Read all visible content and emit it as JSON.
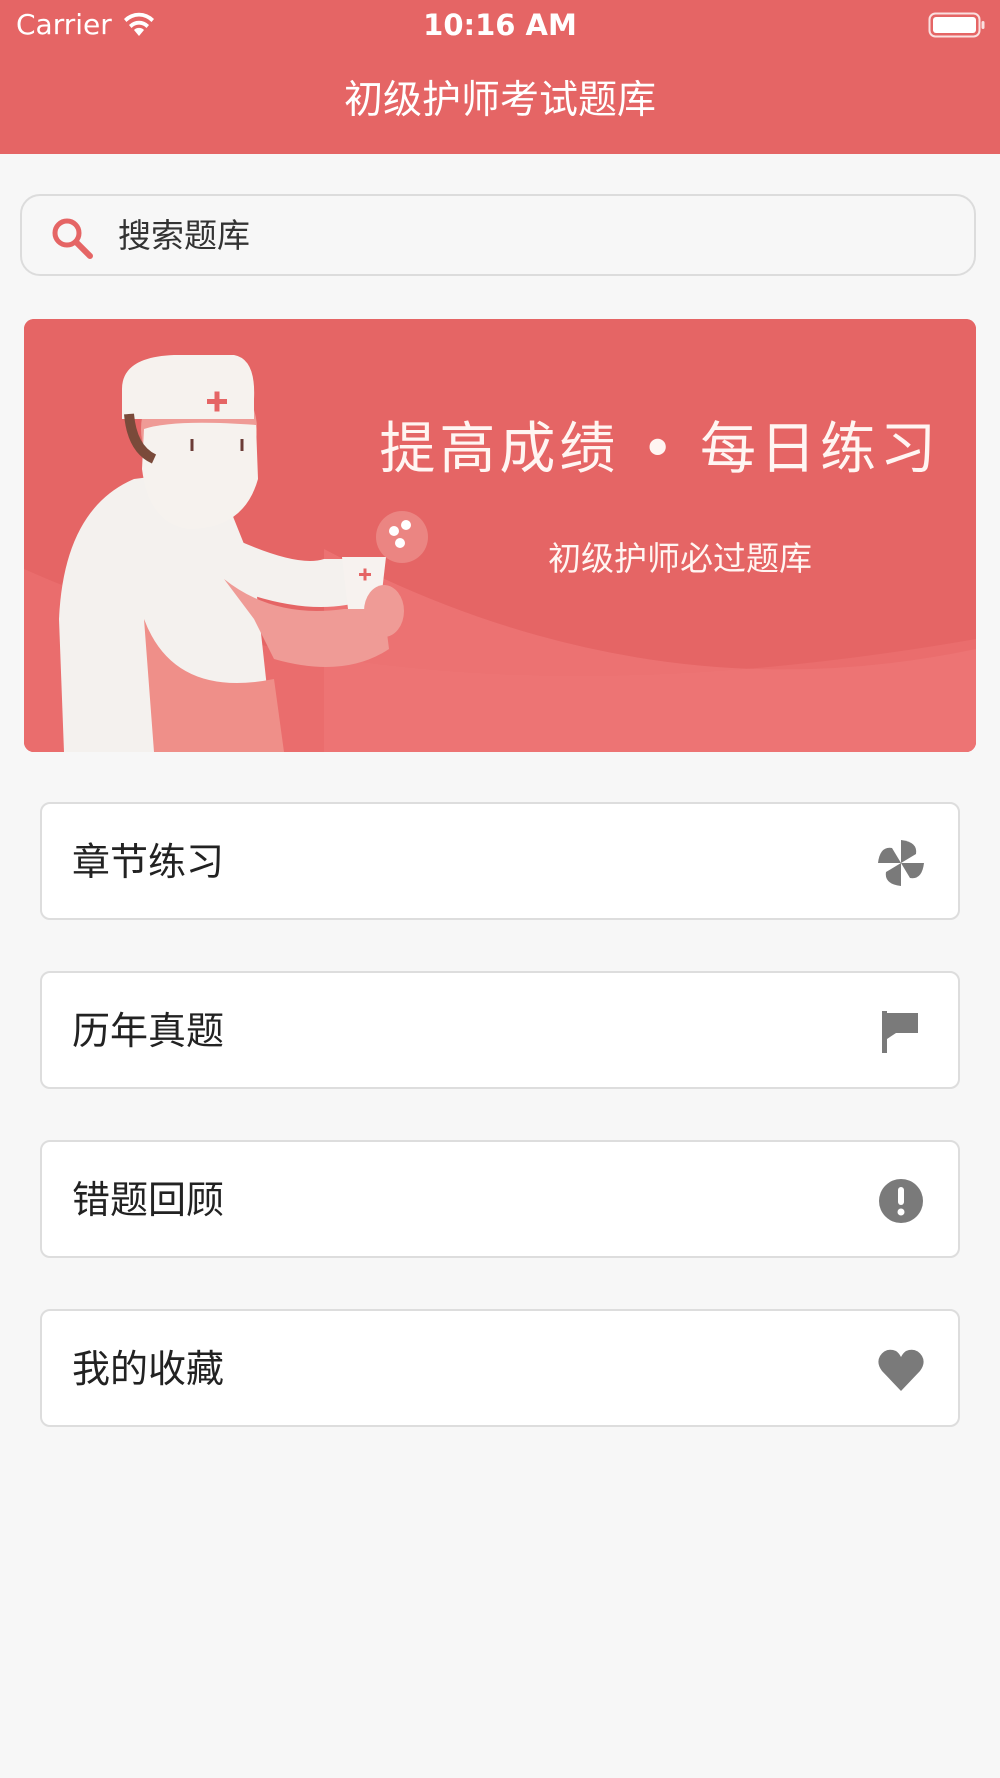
{
  "status_bar": {
    "carrier": "Carrier",
    "time": "10:16 AM",
    "wifi_icon": "wifi-icon",
    "battery_icon": "battery-icon"
  },
  "nav": {
    "title": "初级护师考试题库"
  },
  "search": {
    "placeholder": "搜索题库",
    "icon": "search-icon"
  },
  "banner": {
    "heading": "提高成绩 • 每日练习",
    "subtitle": "初级护师必过题库"
  },
  "menu": [
    {
      "label": "章节练习",
      "icon": "pinwheel-icon"
    },
    {
      "label": "历年真题",
      "icon": "flag-icon"
    },
    {
      "label": "错题回顾",
      "icon": "exclamation-icon"
    },
    {
      "label": "我的收藏",
      "icon": "heart-icon"
    }
  ],
  "colors": {
    "accent": "#e56565",
    "background": "#f7f7f7",
    "card": "#ffffff",
    "icon_gray": "#7a7a7a"
  }
}
